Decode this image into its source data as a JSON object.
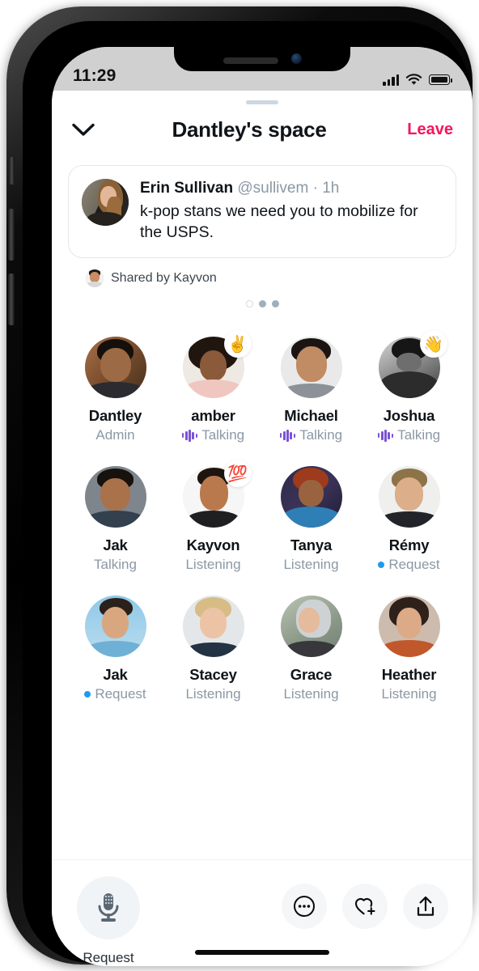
{
  "status_bar": {
    "time": "11:29",
    "signal_icon": "signal-bars-icon",
    "wifi_icon": "wifi-icon",
    "battery_icon": "battery-full-icon"
  },
  "header": {
    "collapse_icon": "chevron-down-icon",
    "title": "Dantley's space",
    "leave_label": "Leave",
    "leave_color": "#f4165c"
  },
  "shared_card": {
    "author_name": "Erin Sullivan",
    "author_handle": "@sullivem",
    "separator": "·",
    "timestamp": "1h",
    "body": "k-pop stans we need you to mobilize for the USPS.",
    "shared_by": "Shared by Kayvon",
    "pager": {
      "count": 3,
      "active_index": 0
    }
  },
  "people": [
    [
      {
        "name": "Dantley",
        "status": "Admin",
        "status_icon": "none",
        "emoji": ""
      },
      {
        "name": "amber",
        "status": "Talking",
        "status_icon": "waveform-icon",
        "emoji": "✌️"
      },
      {
        "name": "Michael",
        "status": "Talking",
        "status_icon": "waveform-icon",
        "emoji": ""
      },
      {
        "name": "Joshua",
        "status": "Talking",
        "status_icon": "waveform-icon",
        "emoji": "👋"
      }
    ],
    [
      {
        "name": "Jak",
        "status": "Talking",
        "status_icon": "none",
        "emoji": ""
      },
      {
        "name": "Kayvon",
        "status": "Listening",
        "status_icon": "none",
        "emoji": "💯"
      },
      {
        "name": "Tanya",
        "status": "Listening",
        "status_icon": "none",
        "emoji": ""
      },
      {
        "name": "Rémy",
        "status": "Request",
        "status_icon": "blue-dot-icon",
        "emoji": ""
      }
    ],
    [
      {
        "name": "Jak",
        "status": "Request",
        "status_icon": "blue-dot-icon",
        "emoji": ""
      },
      {
        "name": "Stacey",
        "status": "Listening",
        "status_icon": "none",
        "emoji": ""
      },
      {
        "name": "Grace",
        "status": "Listening",
        "status_icon": "none",
        "emoji": ""
      },
      {
        "name": "Heather",
        "status": "Listening",
        "status_icon": "none",
        "emoji": ""
      }
    ]
  ],
  "bottom_bar": {
    "mic_icon": "microphone-icon",
    "mic_label": "Request",
    "more_icon": "more-dots-circle-icon",
    "heart_add_icon": "heart-plus-icon",
    "share_icon": "share-upload-icon"
  },
  "colors": {
    "talking_accent": "#7b52d6",
    "request_accent": "#1d9bf0",
    "leave_accent": "#f4165c",
    "muted_text": "#8b98a5"
  }
}
